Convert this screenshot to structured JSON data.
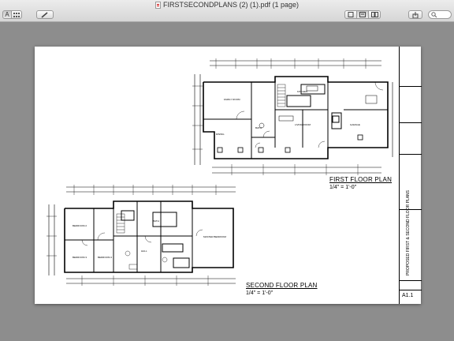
{
  "window": {
    "title": "FIRSTSECONDPLANS (2) (1).pdf (1 page)"
  },
  "toolbar": {
    "view_icon_label": "A",
    "icons": [
      "sidebar-icon",
      "thumbnail-grid-icon",
      "annotate-pencil-icon",
      "single-page-icon",
      "two-page-icon",
      "continuous-icon",
      "share-icon",
      "search-icon"
    ]
  },
  "drawing": {
    "first_floor": {
      "title": "FIRST FLOOR PLAN",
      "scale": "1/4\" = 1'-0\""
    },
    "second_floor": {
      "title": "SECOND FLOOR PLAN",
      "scale": "1/4\" = 1'-0\""
    },
    "title_block": {
      "project_title": "PROPOSED FIRST & SECOND FLOOR PLANS",
      "sheet_number": "A1.1"
    }
  }
}
